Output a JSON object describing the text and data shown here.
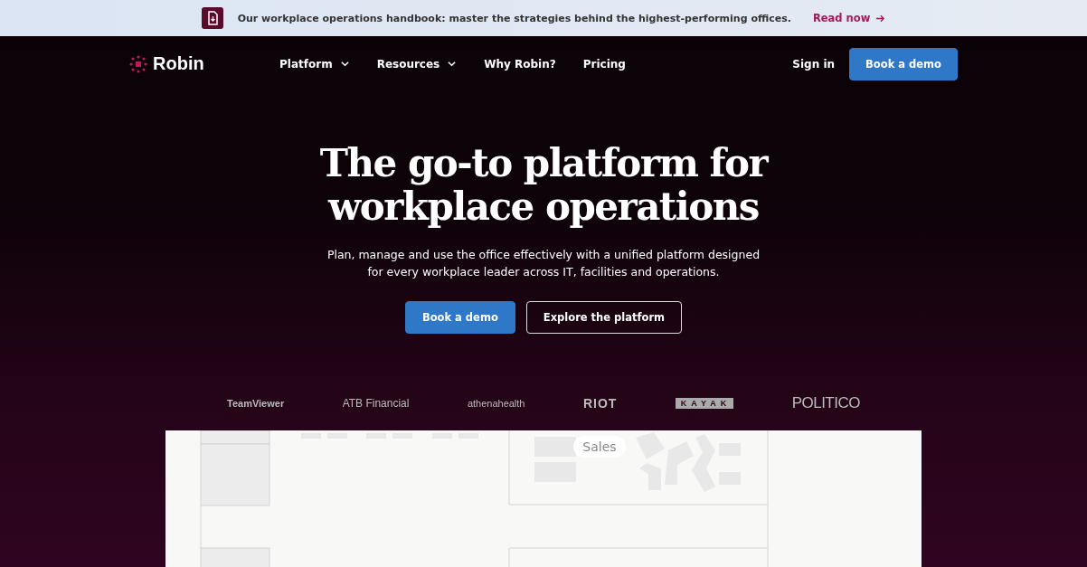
{
  "announcement": {
    "text": "Our workplace operations handbook: master the strategies behind the highest-performing offices.",
    "link": "Read now"
  },
  "nav": {
    "brand": "Robin",
    "items": [
      {
        "label": "Platform",
        "dropdown": true
      },
      {
        "label": "Resources",
        "dropdown": true
      },
      {
        "label": "Why Robin?",
        "dropdown": false
      },
      {
        "label": "Pricing",
        "dropdown": false
      }
    ],
    "sign_in": "Sign in",
    "cta": "Book a demo"
  },
  "hero": {
    "title_lines": [
      "The go-to platform for",
      "workplace operations"
    ],
    "subtitle_lines": [
      "Plan, manage and use the office effectively with a unified platform designed",
      "for every workplace leader across IT, facilities and operations."
    ],
    "buttons": [
      {
        "label": "Book a demo",
        "kind": "primary"
      },
      {
        "label": "Explore the platform",
        "kind": "outline"
      }
    ]
  },
  "logos": [
    {
      "label": "TeamViewer",
      "kind": "teamviewer"
    },
    {
      "label": "ATB Financial",
      "kind": "atb"
    },
    {
      "label": "athenahealth",
      "kind": "athena"
    },
    {
      "label": "RIOT",
      "kind": "riot"
    },
    {
      "label": "KAYAK",
      "kind": "kayak"
    },
    {
      "label": "POLITICO",
      "kind": "politico"
    }
  ],
  "floor_plan": {
    "room_label": "Sales"
  }
}
